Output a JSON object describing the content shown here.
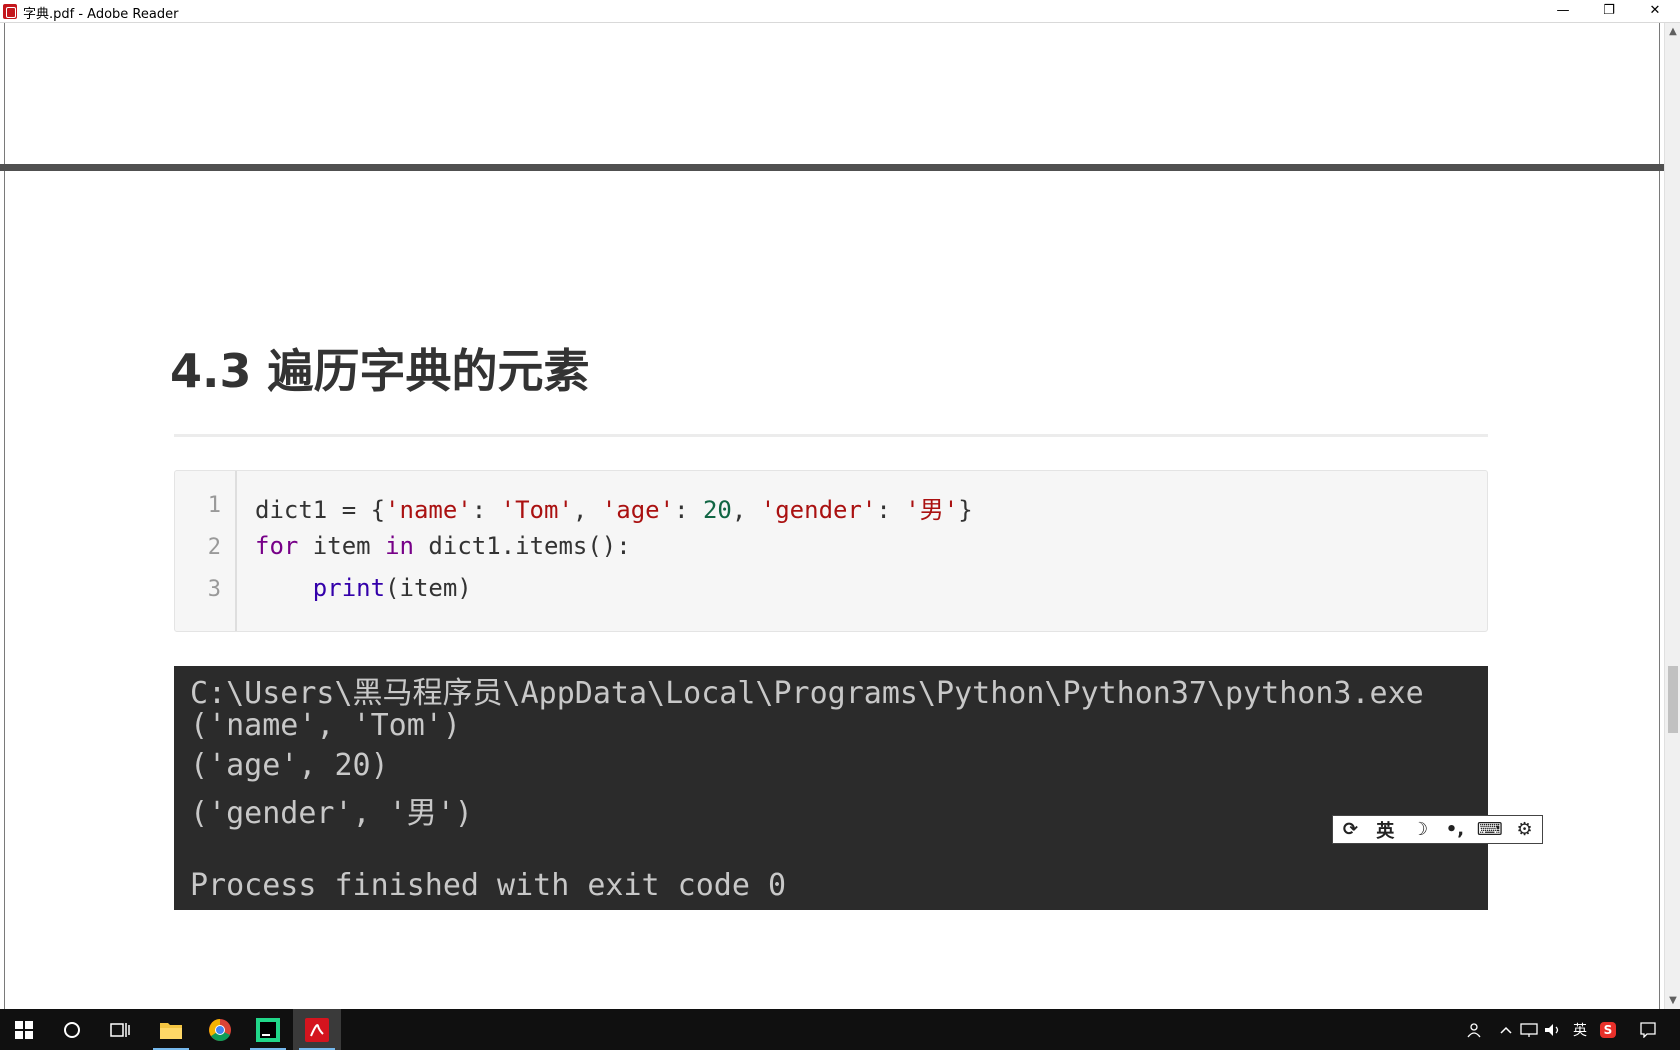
{
  "window": {
    "title": "字典.pdf - Adobe Reader",
    "minimize": "—",
    "restore": "❐",
    "close": "✕"
  },
  "section": {
    "heading": "4.3 遍历字典的元素"
  },
  "code": {
    "line_numbers": [
      "1",
      "2",
      "3"
    ],
    "lines": [
      {
        "t1": "dict1 = {",
        "s1": "'name'",
        "t2": ": ",
        "s2": "'Tom'",
        "t3": ", ",
        "s3": "'age'",
        "t4": ": ",
        "n1": "20",
        "t5": ", ",
        "s4": "'gender'",
        "t6": ": ",
        "s5": "'男'",
        "t7": "}"
      },
      {
        "kw1": "for",
        "t1": " item ",
        "kw2": "in",
        "t2": " dict1.items():"
      },
      {
        "indent": "    ",
        "fn": "print",
        "t1": "(item)"
      }
    ]
  },
  "console": {
    "lines": [
      "C:\\Users\\黑马程序员\\AppData\\Local\\Programs\\Python\\Python37\\python3.exe",
      "('name', 'Tom')",
      "('age', 20)",
      "('gender', '男')",
      "",
      "Process finished with exit code 0"
    ]
  },
  "ime": {
    "items": [
      "⟳",
      "英",
      "☽",
      "•,",
      "⌨",
      "⚙"
    ]
  },
  "scrollbar": {
    "up": "▲",
    "down": "▼",
    "position_fraction": 0.66
  },
  "taskbar": {
    "tray_language": "英",
    "tray_ime": "S"
  },
  "colors": {
    "string": "#aa1111",
    "number": "#116644",
    "keyword": "#770088",
    "builtin": "#3300aa",
    "console_bg": "#2b2b2b",
    "console_text": "#c8c8c8"
  }
}
